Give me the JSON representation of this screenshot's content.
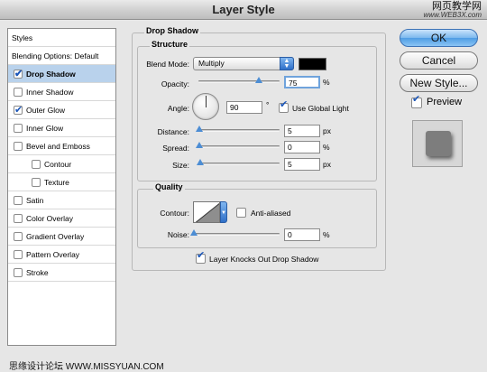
{
  "window": {
    "title": "Layer Style",
    "watermark_cn": "网页教学网",
    "watermark_url": "www.WEB3X.com"
  },
  "sidebar": {
    "header": "Styles",
    "blending": "Blending Options: Default",
    "items": [
      {
        "label": "Drop Shadow",
        "checked": true,
        "selected": true,
        "indent": 1
      },
      {
        "label": "Inner Shadow",
        "checked": false,
        "selected": false,
        "indent": 1
      },
      {
        "label": "Outer Glow",
        "checked": true,
        "selected": false,
        "indent": 1
      },
      {
        "label": "Inner Glow",
        "checked": false,
        "selected": false,
        "indent": 1
      },
      {
        "label": "Bevel and Emboss",
        "checked": false,
        "selected": false,
        "indent": 1
      },
      {
        "label": "Contour",
        "checked": false,
        "selected": false,
        "indent": 2
      },
      {
        "label": "Texture",
        "checked": false,
        "selected": false,
        "indent": 2
      },
      {
        "label": "Satin",
        "checked": false,
        "selected": false,
        "indent": 1
      },
      {
        "label": "Color Overlay",
        "checked": false,
        "selected": false,
        "indent": 1
      },
      {
        "label": "Gradient Overlay",
        "checked": false,
        "selected": false,
        "indent": 1
      },
      {
        "label": "Pattern Overlay",
        "checked": false,
        "selected": false,
        "indent": 1
      },
      {
        "label": "Stroke",
        "checked": false,
        "selected": false,
        "indent": 1
      }
    ]
  },
  "drop_shadow": {
    "title": "Drop Shadow",
    "structure": {
      "title": "Structure",
      "blend_mode_label": "Blend Mode:",
      "blend_mode_value": "Multiply",
      "shadow_color": "#000000",
      "opacity_label": "Opacity:",
      "opacity_value": "75",
      "opacity_fraction": 0.75,
      "opacity_unit": "%",
      "angle_label": "Angle:",
      "angle_value": "90",
      "angle_unit": "°",
      "global_light_label": "Use Global Light",
      "global_light_checked": true,
      "distance_label": "Distance:",
      "distance_value": "5",
      "distance_unit": "px",
      "spread_label": "Spread:",
      "spread_value": "0",
      "spread_unit": "%",
      "size_label": "Size:",
      "size_value": "5",
      "size_unit": "px"
    },
    "quality": {
      "title": "Quality",
      "contour_label": "Contour:",
      "anti_aliased_label": "Anti-aliased",
      "anti_aliased_checked": false,
      "noise_label": "Noise:",
      "noise_value": "0",
      "noise_unit": "%"
    },
    "knockout_label": "Layer Knocks Out Drop Shadow",
    "knockout_checked": true
  },
  "buttons": {
    "ok": "OK",
    "cancel": "Cancel",
    "new_style": "New Style...",
    "preview_label": "Preview",
    "preview_checked": true
  },
  "footer": {
    "watermark": "思缘设计论坛  WWW.MISSYUAN.COM"
  }
}
